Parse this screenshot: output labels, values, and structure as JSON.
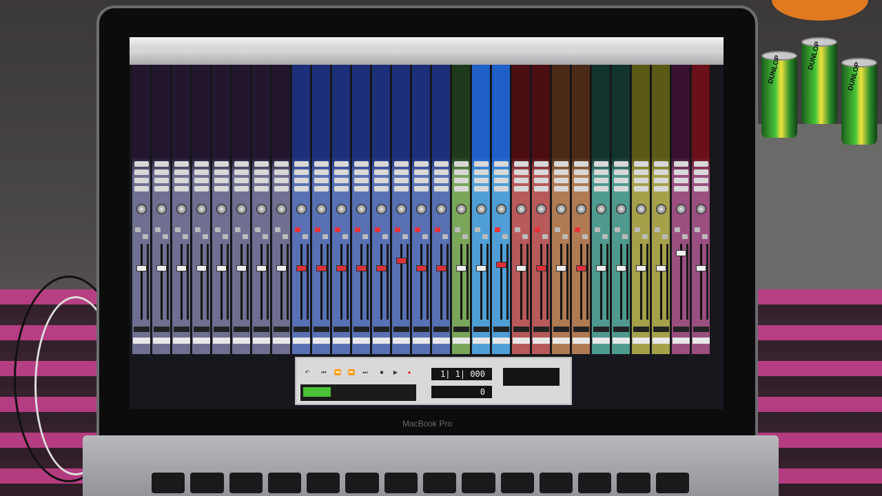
{
  "scene": {
    "laptop_brand": "MacBook Pro",
    "can_brand": "DUNLOP"
  },
  "transport": {
    "main_counter": "1| 1| 000",
    "sub_counter": "0"
  },
  "colors": {
    "strip_purple": "#6f6f92",
    "strip_blue": "#5871b4",
    "strip_green": "#7aa65a",
    "strip_lightblue": "#4f9fd6",
    "strip_red": "#b85a5a",
    "strip_orange": "#b07a52",
    "strip_teal": "#4f9a8e",
    "strip_olive": "#a5a04a",
    "strip_magenta": "#9a4f80"
  },
  "strips": [
    {
      "c": "strip_purple",
      "fader": 0.28,
      "rec": false,
      "top": "#22172f"
    },
    {
      "c": "strip_purple",
      "fader": 0.28,
      "rec": false,
      "top": "#22172f"
    },
    {
      "c": "strip_purple",
      "fader": 0.28,
      "rec": false,
      "top": "#22172f"
    },
    {
      "c": "strip_purple",
      "fader": 0.28,
      "rec": false,
      "top": "#22172f"
    },
    {
      "c": "strip_purple",
      "fader": 0.28,
      "rec": false,
      "top": "#22172f"
    },
    {
      "c": "strip_purple",
      "fader": 0.28,
      "rec": false,
      "top": "#22172f"
    },
    {
      "c": "strip_purple",
      "fader": 0.28,
      "rec": false,
      "top": "#22172f"
    },
    {
      "c": "strip_purple",
      "fader": 0.28,
      "rec": false,
      "top": "#22172f"
    },
    {
      "c": "strip_blue",
      "fader": 0.28,
      "rec": true,
      "top": "#1e2f7a"
    },
    {
      "c": "strip_blue",
      "fader": 0.28,
      "rec": true,
      "top": "#1e2f7a"
    },
    {
      "c": "strip_blue",
      "fader": 0.28,
      "rec": true,
      "top": "#1e2f7a"
    },
    {
      "c": "strip_blue",
      "fader": 0.28,
      "rec": true,
      "top": "#1e2f7a"
    },
    {
      "c": "strip_blue",
      "fader": 0.28,
      "rec": true,
      "top": "#1e2f7a"
    },
    {
      "c": "strip_blue",
      "fader": 0.18,
      "rec": true,
      "top": "#1e2f7a"
    },
    {
      "c": "strip_blue",
      "fader": 0.28,
      "rec": true,
      "top": "#1e2f7a"
    },
    {
      "c": "strip_blue",
      "fader": 0.28,
      "rec": true,
      "top": "#1e2f7a"
    },
    {
      "c": "strip_green",
      "fader": 0.28,
      "rec": false,
      "top": "#1d3a1d"
    },
    {
      "c": "strip_lightblue",
      "fader": 0.28,
      "rec": false,
      "top": "#1f5fc8"
    },
    {
      "c": "strip_lightblue",
      "fader": 0.24,
      "rec": true,
      "top": "#1f5fc8"
    },
    {
      "c": "strip_red",
      "fader": 0.28,
      "rec": false,
      "top": "#4a0d12"
    },
    {
      "c": "strip_red",
      "fader": 0.28,
      "rec": true,
      "top": "#4a0d12"
    },
    {
      "c": "strip_orange",
      "fader": 0.28,
      "rec": false,
      "top": "#4a2a16"
    },
    {
      "c": "strip_orange",
      "fader": 0.28,
      "rec": true,
      "top": "#4a2a16"
    },
    {
      "c": "strip_teal",
      "fader": 0.28,
      "rec": false,
      "top": "#12332e"
    },
    {
      "c": "strip_teal",
      "fader": 0.28,
      "rec": false,
      "top": "#12332e"
    },
    {
      "c": "strip_olive",
      "fader": 0.28,
      "rec": false,
      "top": "#5a5a16"
    },
    {
      "c": "strip_olive",
      "fader": 0.28,
      "rec": false,
      "top": "#5a5a16"
    },
    {
      "c": "strip_magenta",
      "fader": 0.08,
      "rec": false,
      "top": "#3a1030"
    },
    {
      "c": "strip_magenta",
      "fader": 0.28,
      "rec": false,
      "top": "#6a1018"
    }
  ]
}
